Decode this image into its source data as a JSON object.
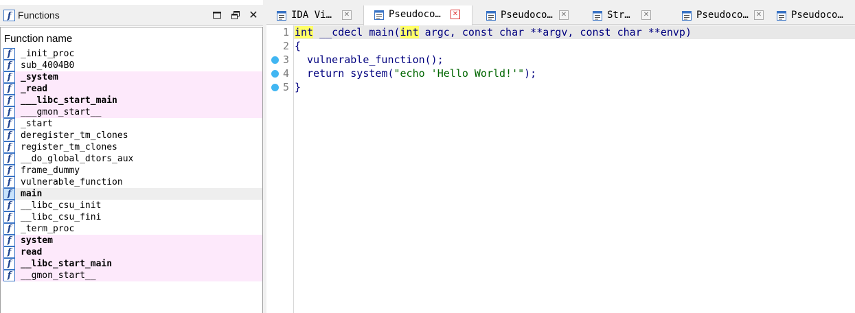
{
  "functions_panel": {
    "title": "Functions",
    "column_header": "Function name",
    "function_icon_glyph": "f",
    "rows": [
      {
        "name": "_init_proc",
        "highlight": "none",
        "bold": false
      },
      {
        "name": "sub_4004B0",
        "highlight": "none",
        "bold": false
      },
      {
        "name": "_system",
        "highlight": "pink",
        "bold": true
      },
      {
        "name": "_read",
        "highlight": "pink",
        "bold": true
      },
      {
        "name": "___libc_start_main",
        "highlight": "pink",
        "bold": true
      },
      {
        "name": "___gmon_start__",
        "highlight": "pink",
        "bold": false
      },
      {
        "name": "_start",
        "highlight": "none",
        "bold": false
      },
      {
        "name": "deregister_tm_clones",
        "highlight": "none",
        "bold": false
      },
      {
        "name": "register_tm_clones",
        "highlight": "none",
        "bold": false
      },
      {
        "name": "__do_global_dtors_aux",
        "highlight": "none",
        "bold": false
      },
      {
        "name": "frame_dummy",
        "highlight": "none",
        "bold": false
      },
      {
        "name": "vulnerable_function",
        "highlight": "none",
        "bold": false
      },
      {
        "name": "main",
        "highlight": "selected",
        "bold": true
      },
      {
        "name": "__libc_csu_init",
        "highlight": "none",
        "bold": false
      },
      {
        "name": "__libc_csu_fini",
        "highlight": "none",
        "bold": false
      },
      {
        "name": "_term_proc",
        "highlight": "none",
        "bold": false
      },
      {
        "name": "system",
        "highlight": "pink",
        "bold": true
      },
      {
        "name": "read",
        "highlight": "pink",
        "bold": true
      },
      {
        "name": "__libc_start_main",
        "highlight": "pink",
        "bold": true
      },
      {
        "name": "__gmon_start__",
        "highlight": "pink",
        "bold": false
      }
    ],
    "close_glyph": "✕"
  },
  "tabs": [
    {
      "label": "IDA Vi…",
      "icon": "ida-view-icon",
      "active": false,
      "close_glyph": "✕"
    },
    {
      "label": "Pseudoco…",
      "icon": "pseudocode-icon",
      "active": true,
      "close_glyph": "✕"
    },
    {
      "label": "Pseudoco…",
      "icon": "pseudocode-icon",
      "active": false,
      "close_glyph": "✕"
    },
    {
      "label": "Str…",
      "icon": "strings-icon",
      "active": false,
      "close_glyph": "✕"
    },
    {
      "label": "Pseudoco…",
      "icon": "pseudocode-icon",
      "active": false,
      "close_glyph": "✕"
    },
    {
      "label": "Pseudoco…",
      "icon": "pseudocode-icon",
      "active": false,
      "close_glyph": "✕"
    }
  ],
  "code": {
    "lines": [
      {
        "number": "1",
        "breakpoint": false,
        "text": "int __cdecl main(int argc, const char **argv, const char **envp)"
      },
      {
        "number": "2",
        "breakpoint": false,
        "text": "{"
      },
      {
        "number": "3",
        "breakpoint": true,
        "text": "  vulnerable_function();"
      },
      {
        "number": "4",
        "breakpoint": true,
        "text": "  return system(\"echo 'Hello World!'\");"
      },
      {
        "number": "5",
        "breakpoint": true,
        "text": "}"
      }
    ],
    "line1_parts": [
      "int",
      " __cdecl main(",
      "int",
      " argc, const char **argv, const char **envp)"
    ],
    "line4_parts": [
      "  return system(",
      "\"echo 'Hello World!'\"",
      ");"
    ]
  },
  "colors": {
    "pink_row": "#fde9fb",
    "selected_row": "#eeeeee",
    "breakpoint": "#41b6f2",
    "keyword_highlight": "#ffff66",
    "code_text": "#00007f"
  }
}
